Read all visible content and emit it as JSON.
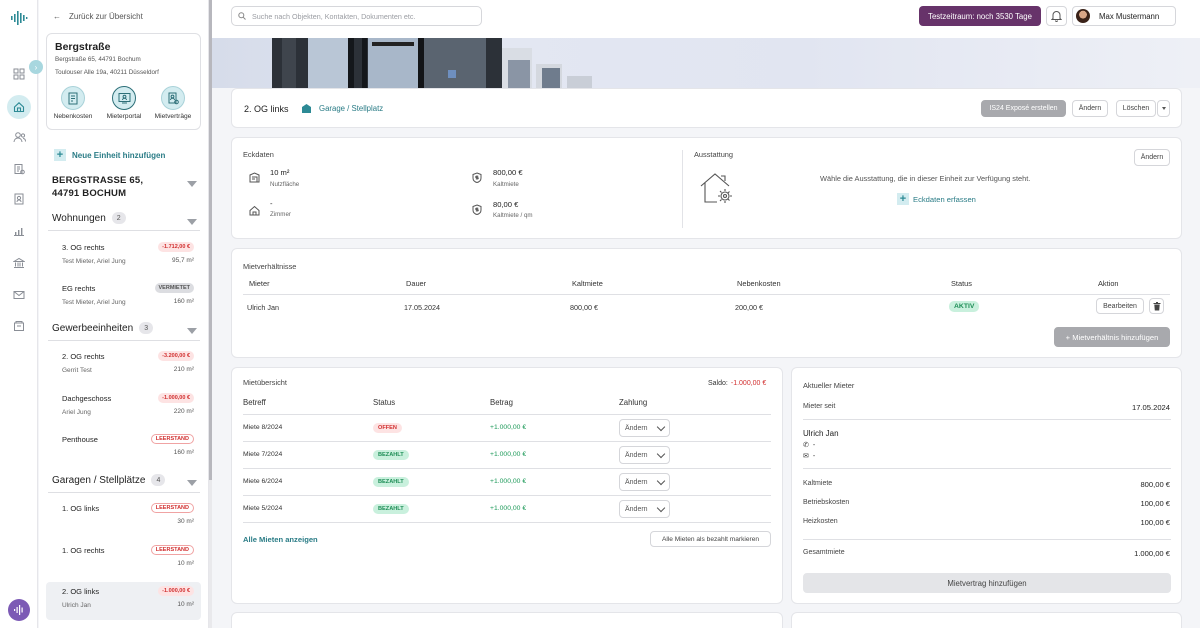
{
  "colors": {
    "accent": "#2d8a95",
    "trial": "#67336a",
    "negative": "#d12f2f",
    "positive": "#1e9a5a"
  },
  "sidebar": {
    "back_label": "Zurück zur Übersicht",
    "property": {
      "title": "Bergstraße",
      "address": "Bergstraße 65, 44791 Bochum",
      "owner_address": "Toulouser Alle 19a, 40211 Düsseldorf"
    },
    "quick_actions": [
      {
        "label": "Nebenkosten",
        "icon": "receipt-icon"
      },
      {
        "label": "Mieterportal",
        "icon": "portal-icon"
      },
      {
        "label": "Mietverträge",
        "icon": "contract-icon"
      }
    ],
    "new_unit_label": "Neue Einheit hinzufügen",
    "address_heading": "BERGSTRASSE 65, 44791 BOCHUM",
    "groups": [
      {
        "name": "Wohnungen",
        "count": "2",
        "units": [
          {
            "name": "3. OG rechts",
            "tenant": "Test Mieter, Ariel Jung",
            "badge": "-1.712,00 €",
            "badge_type": "neg",
            "area": "95,7 m²"
          },
          {
            "name": "EG rechts",
            "tenant": "Test Mieter, Ariel Jung",
            "badge": "VERMIETET",
            "badge_type": "verm",
            "area": "160 m²"
          }
        ]
      },
      {
        "name": "Gewerbeeinheiten",
        "count": "3",
        "units": [
          {
            "name": "2. OG rechts",
            "tenant": "Gerrit Test",
            "badge": "-3.200,00 €",
            "badge_type": "neg",
            "area": "210 m²"
          },
          {
            "name": "Dachgeschoss",
            "tenant": "Ariel Jung",
            "badge": "-1.000,00 €",
            "badge_type": "neg",
            "area": "220 m²"
          },
          {
            "name": "Penthouse",
            "tenant": "",
            "badge": "LEERSTAND",
            "badge_type": "leer",
            "area": "160 m²"
          }
        ]
      },
      {
        "name": "Garagen / Stellplätze",
        "count": "4",
        "units": [
          {
            "name": "1. OG links",
            "tenant": "",
            "badge": "LEERSTAND",
            "badge_type": "leer",
            "area": "30 m²"
          },
          {
            "name": "1. OG rechts",
            "tenant": "",
            "badge": "LEERSTAND",
            "badge_type": "leer",
            "area": "10 m²"
          },
          {
            "name": "2. OG links",
            "tenant": "Ulrich Jan",
            "badge": "-1.000,00 €",
            "badge_type": "neg",
            "area": "10 m²",
            "selected": true
          }
        ]
      }
    ]
  },
  "topbar": {
    "search_placeholder": "Suche nach Objekten, Kontakten, Dokumenten etc.",
    "trial_label": "Testzeitraum: noch 3530 Tage",
    "user_name": "Max Mustermann"
  },
  "unit_header": {
    "name": "2. OG links",
    "type": "Garage / Stellplatz",
    "expose_button": "IS24 Exposé erstellen",
    "edit_button": "Ändern",
    "delete_button": "Löschen"
  },
  "eckdaten": {
    "title": "Eckdaten",
    "items": [
      {
        "value": "10 m²",
        "label": "Nutzfläche",
        "icon": "area-icon"
      },
      {
        "value": "800,00 €",
        "label": "Kaltmiete",
        "icon": "money-icon"
      },
      {
        "value": "-",
        "label": "Zimmer",
        "icon": "home-icon"
      },
      {
        "value": "80,00 €",
        "label": "Kaltmiete / qm",
        "icon": "money-icon"
      }
    ]
  },
  "ausstattung": {
    "title": "Ausstattung",
    "edit_button": "Ändern",
    "text": "Wähle die Ausstattung, die in dieser Einheit zur Verfügung steht.",
    "link": "Eckdaten erfassen"
  },
  "mietverhaeltnisse": {
    "title": "Mietverhältnisse",
    "columns": [
      "Mieter",
      "Dauer",
      "Kaltmiete",
      "Nebenkosten",
      "Status",
      "Aktion"
    ],
    "rows": [
      {
        "mieter": "Ulrich Jan",
        "dauer": "17.05.2024",
        "kaltmiete": "800,00 €",
        "nebenkosten": "200,00 €",
        "status": "AKTIV",
        "action": "Bearbeiten"
      }
    ],
    "add_button": "+ Mietverhältnis hinzufügen"
  },
  "mietuebersicht": {
    "title": "Mietübersicht",
    "saldo_label": "Saldo:",
    "saldo_value": "-1.000,00 €",
    "columns": [
      "Betreff",
      "Status",
      "Betrag",
      "Zahlung"
    ],
    "rows": [
      {
        "betreff": "Miete 8/2024",
        "status": "OFFEN",
        "betrag": "+1.000,00 €",
        "zahlung": "Ändern"
      },
      {
        "betreff": "Miete 7/2024",
        "status": "BEZAHLT",
        "betrag": "+1.000,00 €",
        "zahlung": "Ändern"
      },
      {
        "betreff": "Miete 6/2024",
        "status": "BEZAHLT",
        "betrag": "+1.000,00 €",
        "zahlung": "Ändern"
      },
      {
        "betreff": "Miete 5/2024",
        "status": "BEZAHLT",
        "betrag": "+1.000,00 €",
        "zahlung": "Ändern"
      }
    ],
    "show_all": "Alle Mieten anzeigen",
    "mark_all": "Alle Mieten als bezahlt markieren"
  },
  "tenant": {
    "title": "Aktueller Mieter",
    "since_label": "Mieter seit",
    "since_value": "17.05.2024",
    "name": "Ulrich Jan",
    "phone": "-",
    "email": "-",
    "costs": [
      {
        "label": "Kaltmiete",
        "value": "800,00 €"
      },
      {
        "label": "Betriebskosten",
        "value": "100,00 €"
      },
      {
        "label": "Heizkosten",
        "value": "100,00 €"
      }
    ],
    "total_label": "Gesamtmiete",
    "total_value": "1.000,00 €",
    "contract_button": "Mietvertrag hinzufügen"
  }
}
